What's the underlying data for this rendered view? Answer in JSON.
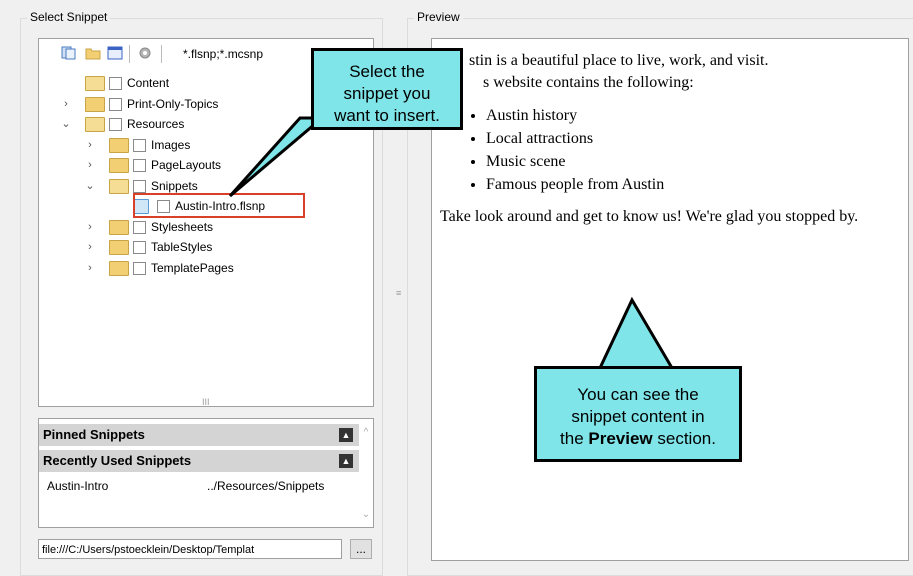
{
  "left_group": {
    "title": "Select Snippet"
  },
  "right_group": {
    "title": "Preview"
  },
  "toolbar": {
    "filter": "*.flsnp;*.mcsnp"
  },
  "tree": [
    {
      "label": "Content",
      "chev": "",
      "open": true
    },
    {
      "label": "Print-Only-Topics",
      "chev": "›",
      "open": false
    },
    {
      "label": "Resources",
      "chev": "⌄",
      "open": true
    },
    {
      "label": "Images",
      "chev": "›",
      "open": false
    },
    {
      "label": "PageLayouts",
      "chev": "›",
      "open": false
    },
    {
      "label": "Snippets",
      "chev": "⌄",
      "open": true
    },
    {
      "label": "Austin-Intro.flsnp",
      "chev": "",
      "open": false
    },
    {
      "label": "Stylesheets",
      "chev": "›",
      "open": false
    },
    {
      "label": "TableStyles",
      "chev": "›",
      "open": false
    },
    {
      "label": "TemplatePages",
      "chev": "›",
      "open": false
    }
  ],
  "snippets": {
    "pinned_header": "Pinned Snippets",
    "recent_header": "Recently Used Snippets",
    "recent_item": {
      "name": "Austin-Intro",
      "path": "../Resources/Snippets"
    }
  },
  "path_field": {
    "value": "file:///C:/Users/pstoecklein/Desktop/Templat"
  },
  "browse_button": {
    "label": "..."
  },
  "preview": {
    "line1": "stin is a beautiful place to live, work, and visit.",
    "line2": "s website contains the following:",
    "bullets": [
      "Austin history",
      "Local attractions",
      "Music scene",
      "Famous people from Austin"
    ],
    "closing": "Take look around and get to know us! We're glad you stopped by."
  },
  "callout_top": {
    "line1": "Select the",
    "line2": "snippet you",
    "line3": "want to insert."
  },
  "callout_bottom": {
    "line1": "You can see the",
    "line2": "snippet content in",
    "line3_prefix": "the ",
    "line3_bold": "Preview",
    "line3_suffix": " section."
  },
  "icons": [
    "copy-icon",
    "folder-icon",
    "grid-icon",
    "gear-icon",
    "snippet-file-icon",
    "collapse-icon"
  ],
  "colors": {
    "callout_fill": "#7fe5e8",
    "highlight_border": "#d9402a",
    "folder": "#f2cf72"
  }
}
